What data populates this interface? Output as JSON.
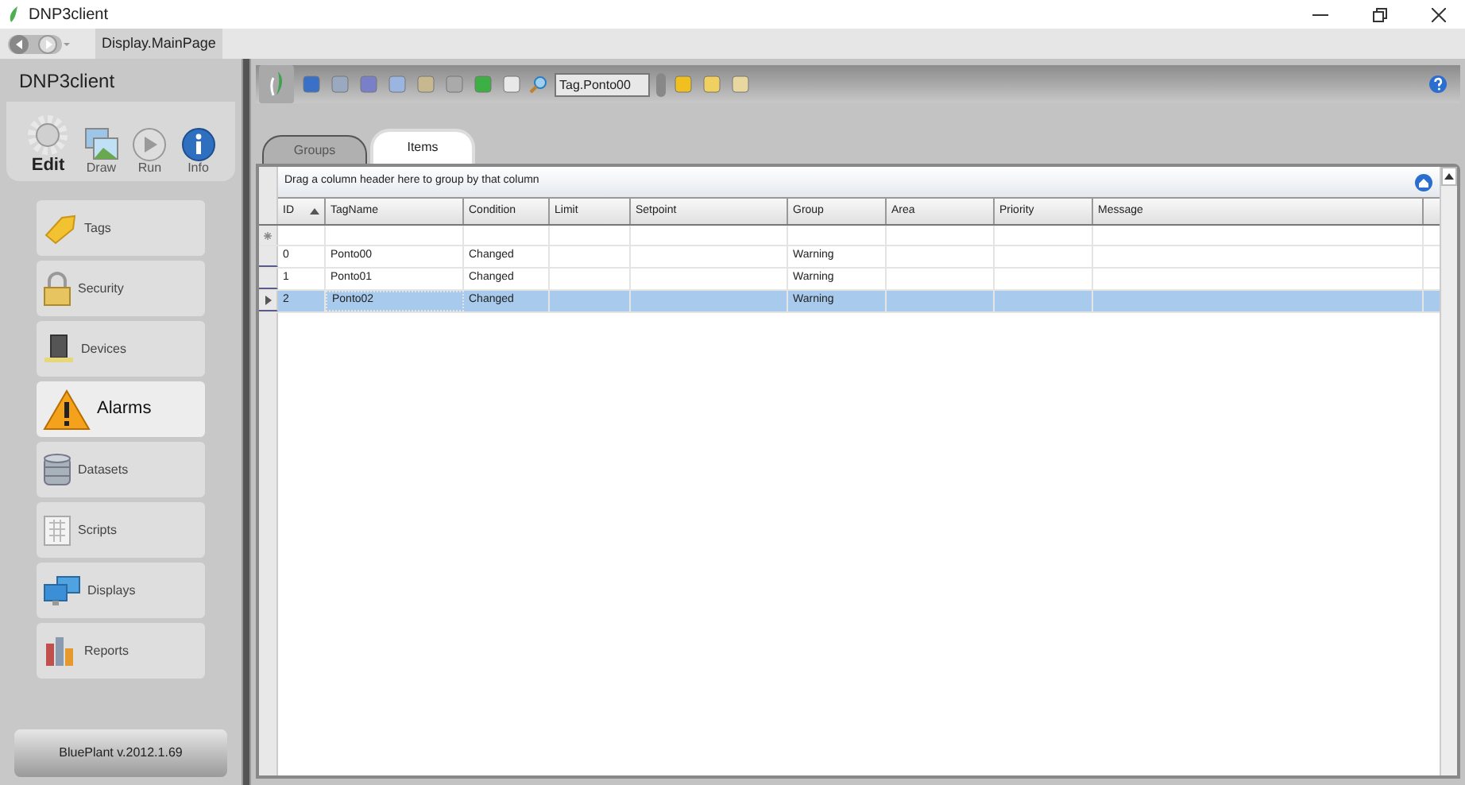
{
  "window": {
    "title": "DNP3client"
  },
  "nav": {
    "page": "Display.MainPage"
  },
  "sidebar": {
    "title": "DNP3client",
    "modes": [
      {
        "label": "Edit",
        "kind": "gear",
        "selected": true
      },
      {
        "label": "Draw",
        "kind": "picture",
        "selected": false
      },
      {
        "label": "Run",
        "kind": "play",
        "selected": false
      },
      {
        "label": "Info",
        "kind": "info",
        "selected": false
      }
    ],
    "items": [
      {
        "label": "Tags",
        "kind": "tag",
        "selected": false
      },
      {
        "label": "Security",
        "kind": "lock",
        "selected": false
      },
      {
        "label": "Devices",
        "kind": "device",
        "selected": false
      },
      {
        "label": "Alarms",
        "kind": "warning",
        "selected": true
      },
      {
        "label": "Datasets",
        "kind": "database",
        "selected": false
      },
      {
        "label": "Scripts",
        "kind": "script",
        "selected": false
      },
      {
        "label": "Displays",
        "kind": "monitor",
        "selected": false
      },
      {
        "label": "Reports",
        "kind": "chart",
        "selected": false
      }
    ],
    "version": "BluePlant  v.2012.1.69"
  },
  "toolbar": {
    "search_value": "Tag.Ponto00"
  },
  "tabs": [
    {
      "label": "Groups",
      "selected": false
    },
    {
      "label": "Items",
      "selected": true
    }
  ],
  "grid": {
    "group_hint": "Drag a column header here to group by that column",
    "columns": [
      "ID",
      "TagName",
      "Condition",
      "Limit",
      "Setpoint",
      "Group",
      "Area",
      "Priority",
      "Message"
    ],
    "rows": [
      {
        "cells": [
          "0",
          "Ponto00",
          "Changed",
          "",
          "",
          "Warning",
          "",
          "",
          ""
        ],
        "selected": false
      },
      {
        "cells": [
          "1",
          "Ponto01",
          "Changed",
          "",
          "",
          "Warning",
          "",
          "",
          ""
        ],
        "selected": false
      },
      {
        "cells": [
          "2",
          "Ponto02",
          "Changed",
          "",
          "",
          "Warning",
          "",
          "",
          ""
        ],
        "selected": true
      }
    ]
  }
}
